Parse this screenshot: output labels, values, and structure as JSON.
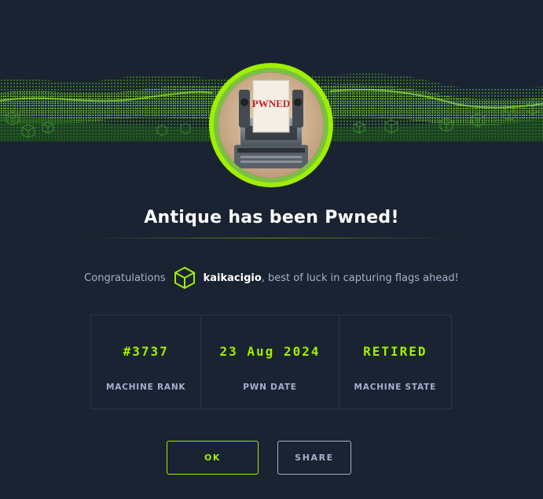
{
  "modal": {
    "title": "Antique has been Pwned!",
    "avatar_sign": "PWNED",
    "congrats_prefix": "Congratulations",
    "username": "kaikacigio",
    "congrats_suffix": ", best of luck in capturing flags ahead!",
    "user_icon": "htb-cube-icon"
  },
  "stats": [
    {
      "value": "#3737",
      "label": "MACHINE RANK"
    },
    {
      "value": "23 Aug 2024",
      "label": "PWN DATE"
    },
    {
      "value": "RETIRED",
      "label": "MACHINE STATE"
    }
  ],
  "buttons": {
    "ok_label": "OK",
    "share_label": "SHARE"
  },
  "colors": {
    "background": "#1a2332",
    "accent": "#9fef00",
    "muted_text": "#a4b1cd",
    "white": "#ffffff"
  }
}
